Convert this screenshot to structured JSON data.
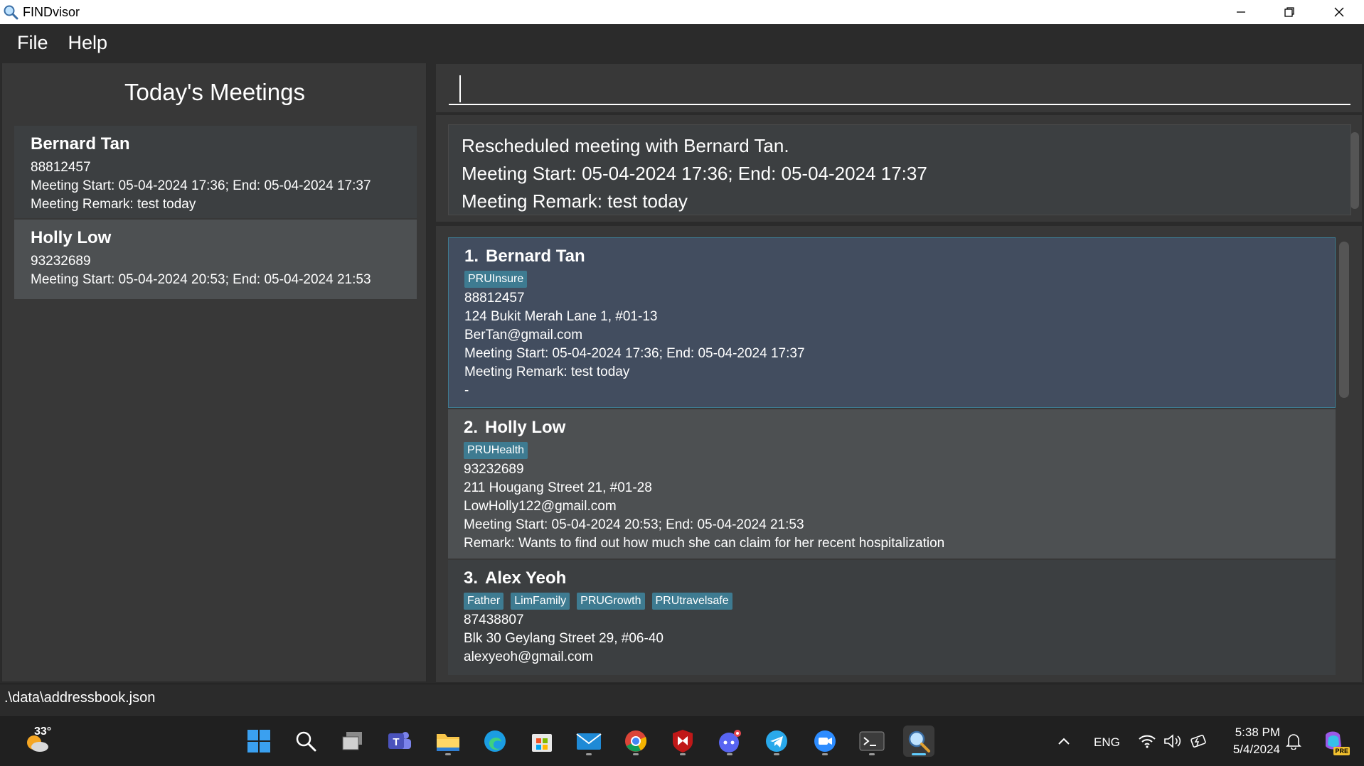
{
  "window": {
    "title": "FINDvisor"
  },
  "menu": {
    "file": "File",
    "help": "Help"
  },
  "todays_meetings": {
    "heading": "Today's Meetings",
    "items": [
      {
        "name": "Bernard Tan",
        "phone": "88812457",
        "meeting": "Meeting Start: 05-04-2024 17:36; End: 05-04-2024 17:37",
        "remark": "Meeting Remark: test today"
      },
      {
        "name": "Holly Low",
        "phone": "93232689",
        "meeting": "Meeting Start: 05-04-2024 20:53; End: 05-04-2024 21:53"
      }
    ]
  },
  "command": {
    "value": ""
  },
  "result": {
    "lines": [
      "Rescheduled meeting with Bernard Tan.",
      "Meeting Start: 05-04-2024 17:36; End: 05-04-2024 17:37",
      "Meeting Remark: test today"
    ]
  },
  "persons": [
    {
      "index": "1.",
      "name": "Bernard Tan",
      "tags": [
        "PRUInsure"
      ],
      "phone": "88812457",
      "address": "124 Bukit Merah Lane 1, #01-13",
      "email": "BerTan@gmail.com",
      "meeting": "Meeting Start: 05-04-2024 17:36; End: 05-04-2024 17:37",
      "meeting_remark": "Meeting Remark: test today",
      "remark": "-"
    },
    {
      "index": "2.",
      "name": "Holly Low",
      "tags": [
        "PRUHealth"
      ],
      "phone": "93232689",
      "address": "211 Hougang Street 21, #01-28",
      "email": "LowHolly122@gmail.com",
      "meeting": "Meeting Start: 05-04-2024 20:53; End: 05-04-2024 21:53",
      "remark": "Remark: Wants to find out how much she can claim for her recent hospitalization"
    },
    {
      "index": "3.",
      "name": "Alex Yeoh",
      "tags": [
        "Father",
        "LimFamily",
        "PRUGrowth",
        "PRUtravelsafe"
      ],
      "phone": "87438807",
      "address": "Blk 30 Geylang Street 29, #06-40",
      "email": "alexyeoh@gmail.com"
    }
  ],
  "status": {
    "path": ".\\data\\addressbook.json"
  },
  "taskbar": {
    "weather": "33°",
    "lang": "ENG",
    "time": "5:38 PM",
    "date": "5/4/2024",
    "pre_badge": "PRE"
  },
  "colors": {
    "accent": "#3e7b91",
    "selected_card": "#424d5f",
    "panel": "#383838",
    "taskbar_active": "#60cdff"
  }
}
